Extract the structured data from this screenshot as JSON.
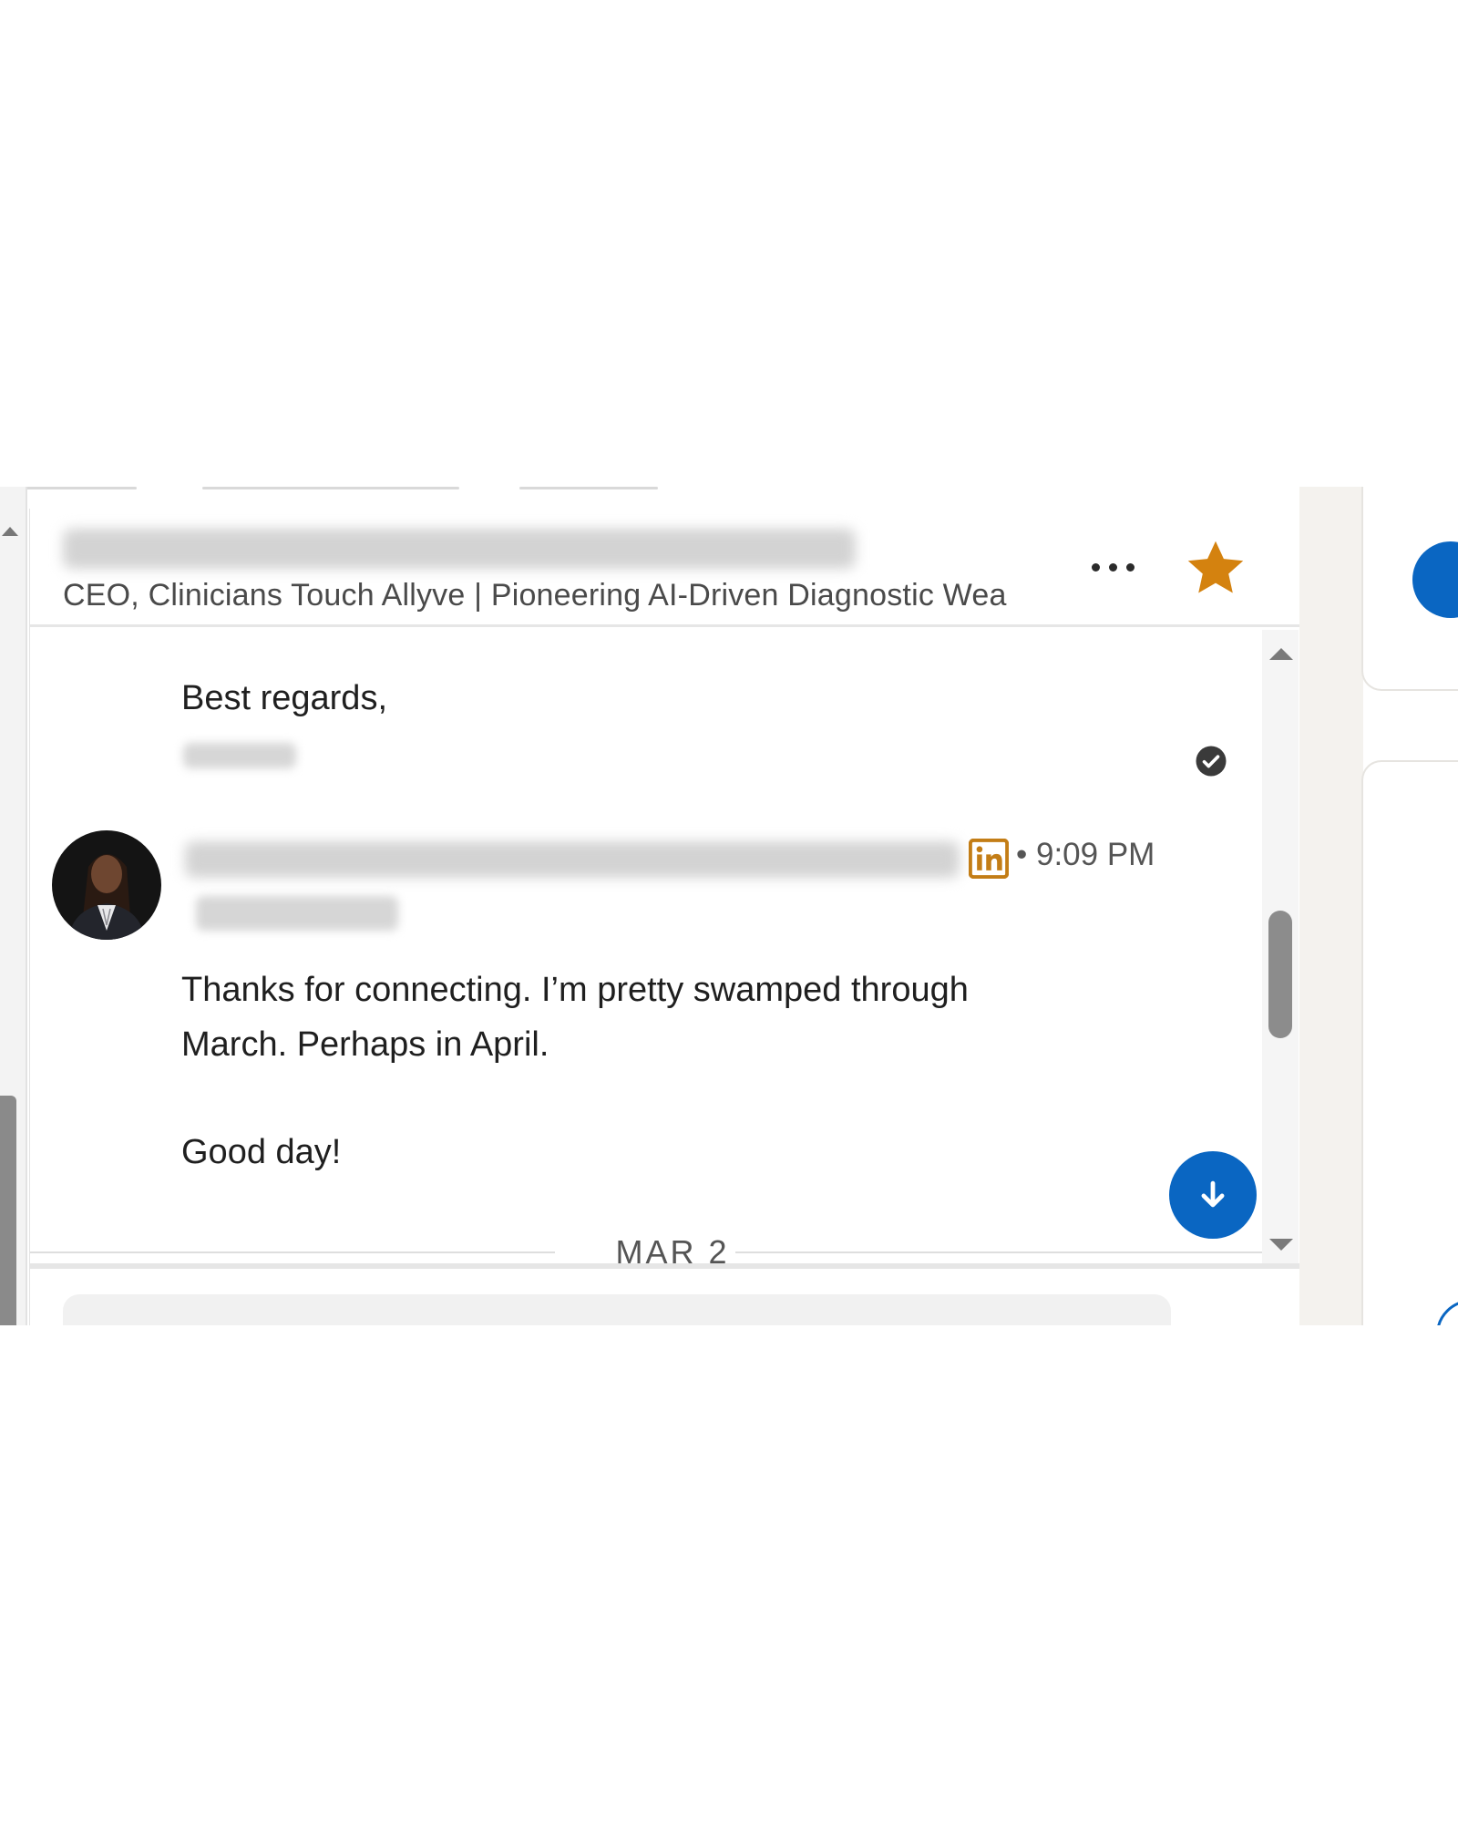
{
  "conversation": {
    "headline": "CEO, Clinicians Touch Allyve | Pioneering AI-Driven Diagnostic Wea"
  },
  "messages": {
    "previous": {
      "line1": "Best regards,"
    },
    "incoming": {
      "time": "• 9:09 PM",
      "line1": "Thanks for connecting. I’m pretty swamped through",
      "line2": "March. Perhaps in April.",
      "line3": "Good day!"
    },
    "date_divider": "MAR 2"
  },
  "colors": {
    "accent": "#0a66c2",
    "star": "#d4820f",
    "linkedin_badge": "#c37d16"
  },
  "icons": {
    "more": "more-horizontal-icon",
    "star": "star-icon",
    "read": "read-receipt-icon",
    "badge": "linkedin-icon",
    "jump": "arrow-down-icon"
  }
}
